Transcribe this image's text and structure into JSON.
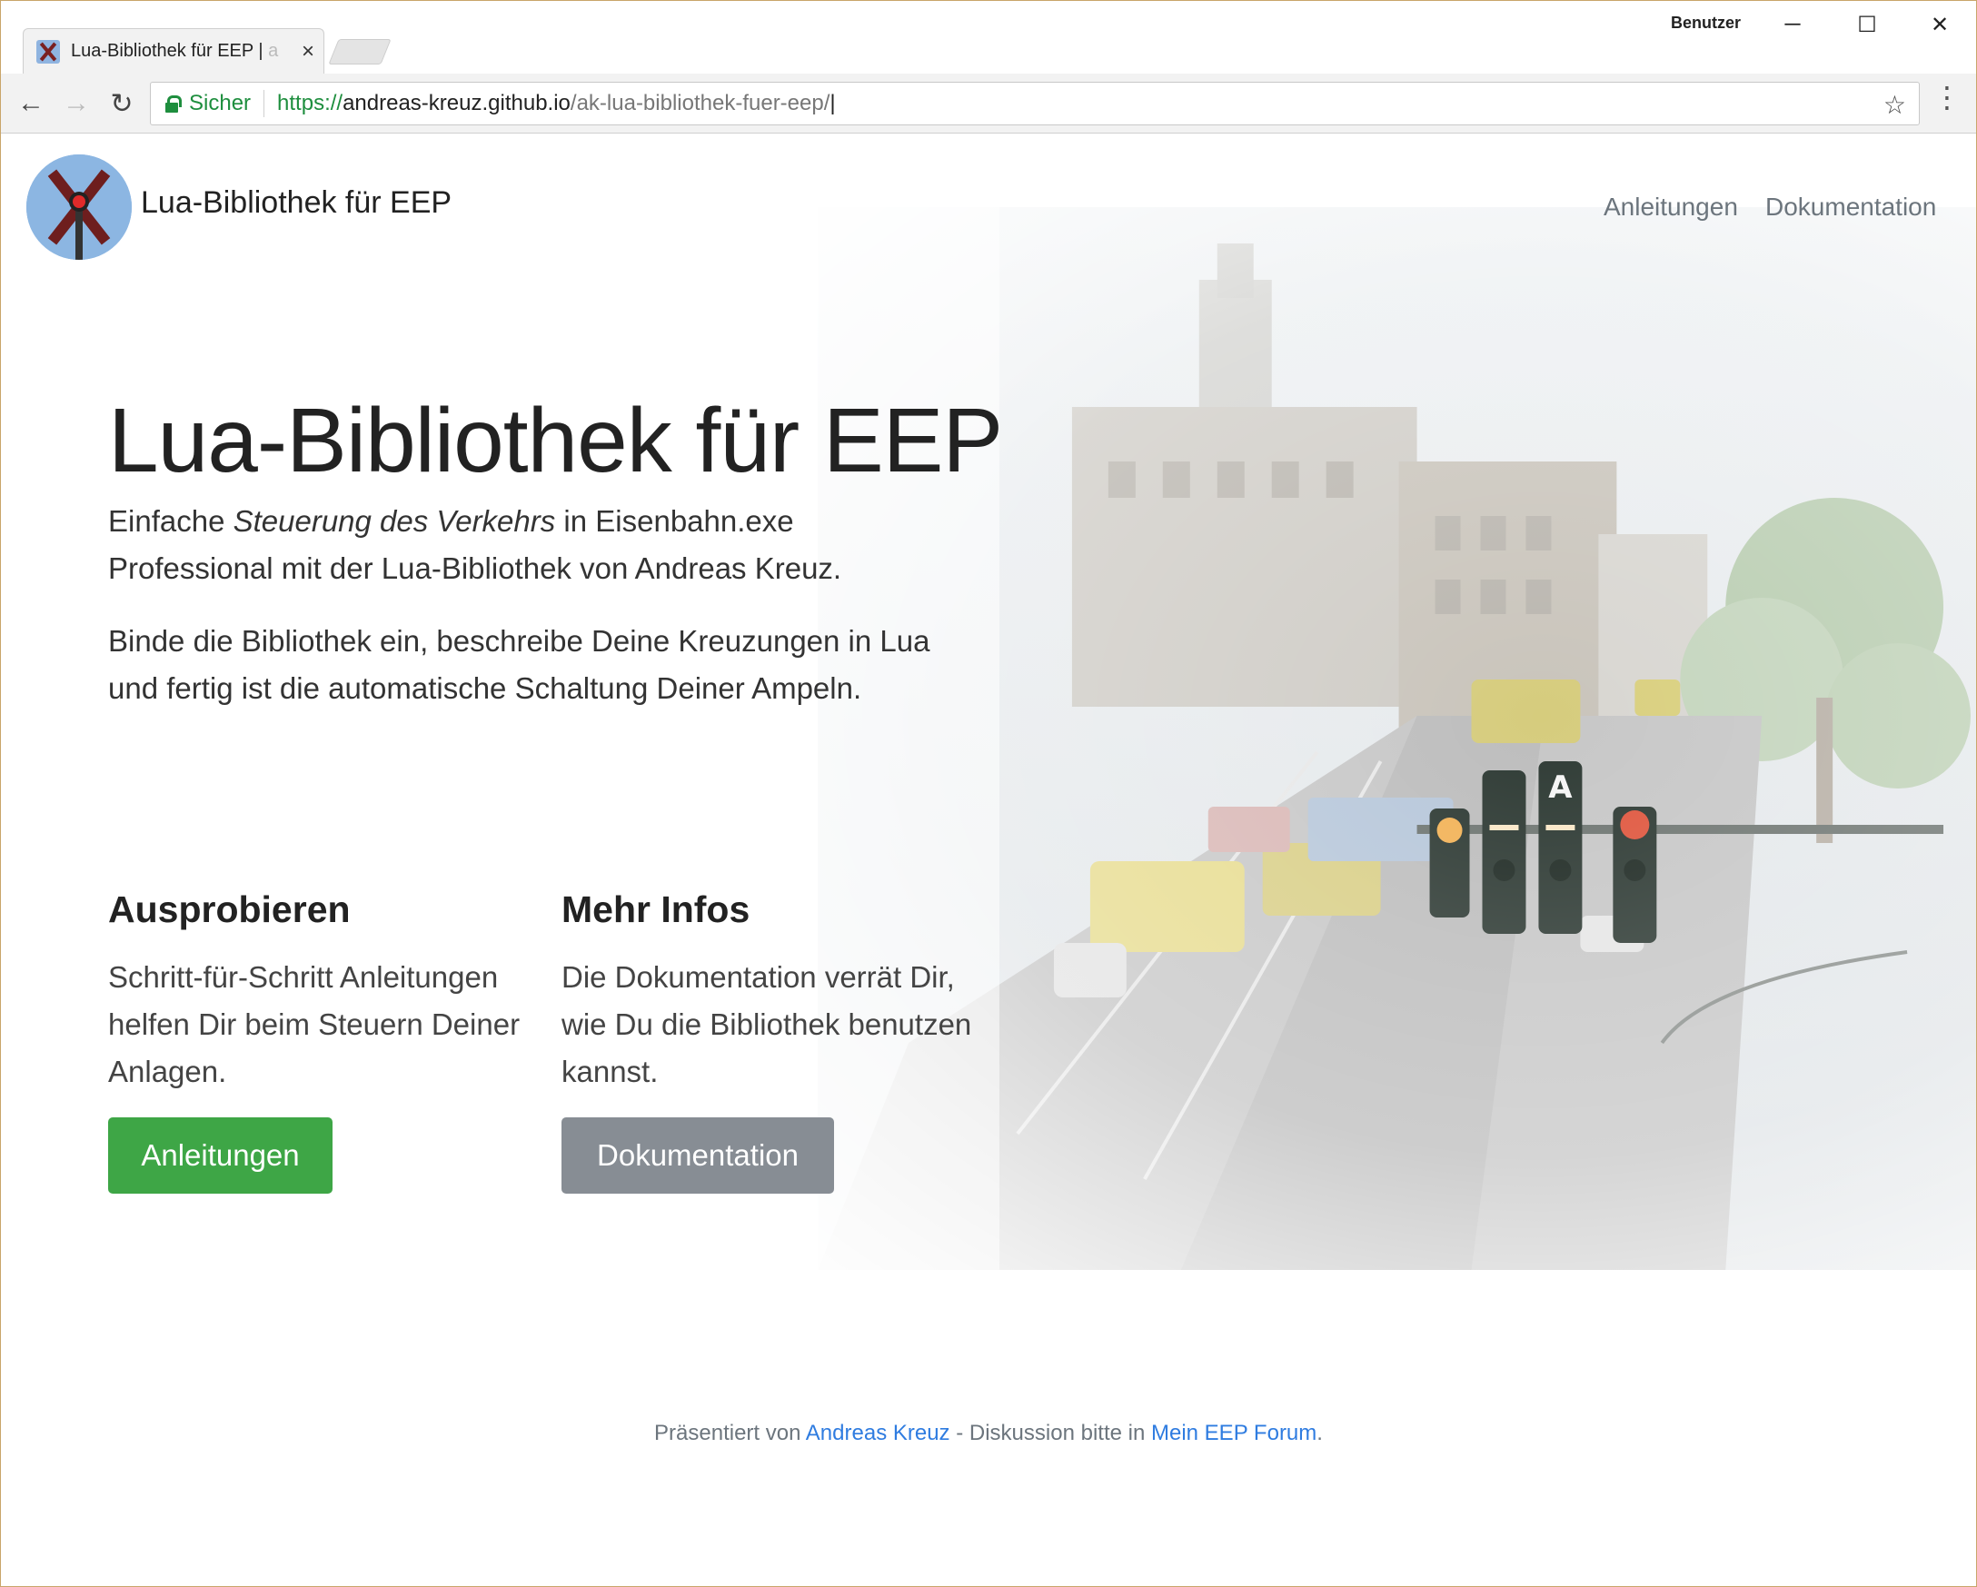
{
  "browser": {
    "tab": {
      "title": "Lua-Bibliothek für EEP |",
      "title_fade": " a",
      "close_glyph": "×"
    },
    "profile_label": "Benutzer",
    "window_controls": {
      "minimize": "─",
      "maximize": "☐",
      "close": "✕"
    },
    "nav": {
      "back": "←",
      "forward": "→",
      "reload": "↻"
    },
    "omnibox": {
      "secure_label": "Sicher",
      "url_scheme": "https://",
      "url_host": "andreas-kreuz.github.io",
      "url_path": "/ak-lua-bibliothek-fuer-eep/",
      "star_glyph": "☆"
    },
    "menu_glyph": "⋮"
  },
  "site": {
    "brand": "Lua-Bibliothek für EEP",
    "nav_links": [
      "Anleitungen",
      "Dokumentation"
    ]
  },
  "hero": {
    "title": "Lua-Bibliothek für EEP",
    "lead1_prefix": "Einfache ",
    "lead1_emphasis": "Steuerung des Verkehrs",
    "lead1_suffix": " in Eisenbahn.exe Professional mit der Lua-Bibliothek von Andreas Kreuz.",
    "lead2": "Binde die Bibliothek ein, beschreibe Deine Kreuzungen in Lua und fertig ist die automatische Schaltung Deiner Ampeln."
  },
  "columns": [
    {
      "heading": "Ausprobieren",
      "text": "Schritt-für-Schritt Anleitungen helfen Dir beim Steuern Deiner Anlagen.",
      "button": "Anleitungen"
    },
    {
      "heading": "Mehr Infos",
      "text": "Die Dokumentation verrät Dir, wie Du die Bibliothek benutzen kannst.",
      "button": "Dokumentation"
    }
  ],
  "footer": {
    "prefix": "Präsentiert von ",
    "author_link": "Andreas Kreuz",
    "middle": " - Diskussion bitte in ",
    "forum_link": "Mein EEP Forum",
    "suffix": "."
  },
  "colors": {
    "success": "#3ea646",
    "secondary": "#878d94",
    "link": "#2f7ce0",
    "secure": "#1e8e3e"
  }
}
